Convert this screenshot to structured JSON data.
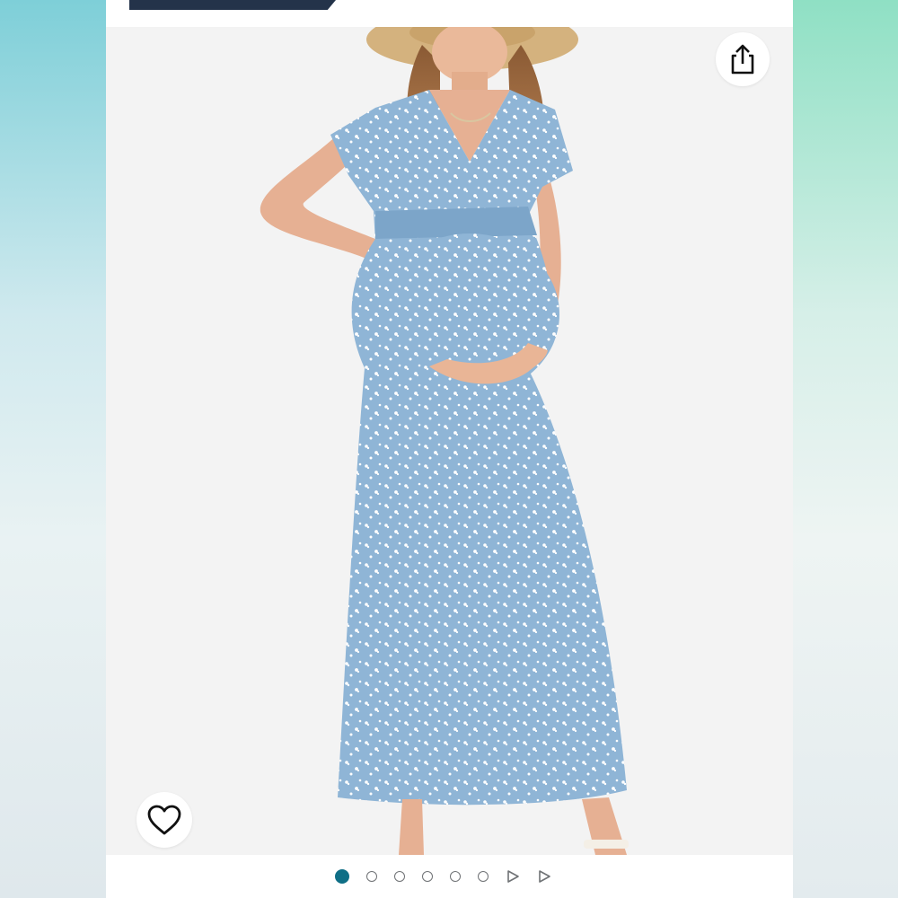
{
  "colors": {
    "brand_tag": "#24334a",
    "active_dot": "#0f6f86",
    "inactive_dot_border": "#6f7275",
    "dress": "#8fb5d6",
    "gallery_bg": "#f3f3f3"
  },
  "icons": {
    "share": "share-icon",
    "favorite": "heart-icon",
    "video": "play-icon"
  },
  "gallery": {
    "image_count": 6,
    "video_count": 2,
    "current_index": 1
  }
}
